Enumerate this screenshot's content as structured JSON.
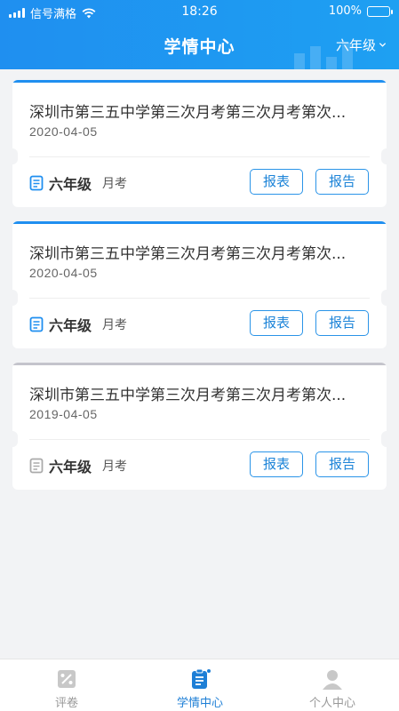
{
  "status_bar": {
    "carrier": "信号满格",
    "time": "18:26",
    "battery": "100%",
    "battery_level": 1.0
  },
  "header": {
    "title": "学情中心",
    "grade_selector": "六年级",
    "accent": "#1f8ff0"
  },
  "exams": [
    {
      "title": "深圳市第三五中学第三次月考第三次月考第次...",
      "date": "2020-04-05",
      "grade": "六年级",
      "type": "月考",
      "btn_table": "报表",
      "btn_report": "报告",
      "active": true
    },
    {
      "title": "深圳市第三五中学第三次月考第三次月考第次...",
      "date": "2020-04-05",
      "grade": "六年级",
      "type": "月考",
      "btn_table": "报表",
      "btn_report": "报告",
      "active": true
    },
    {
      "title": "深圳市第三五中学第三次月考第三次月考第次...",
      "date": "2019-04-05",
      "grade": "六年级",
      "type": "月考",
      "btn_table": "报表",
      "btn_report": "报告",
      "active": false
    }
  ],
  "tabbar": {
    "items": [
      {
        "label": "评卷",
        "icon": "grading-icon",
        "active": false
      },
      {
        "label": "学情中心",
        "icon": "clipboard-icon",
        "active": true
      },
      {
        "label": "个人中心",
        "icon": "user-icon",
        "active": false
      }
    ]
  }
}
